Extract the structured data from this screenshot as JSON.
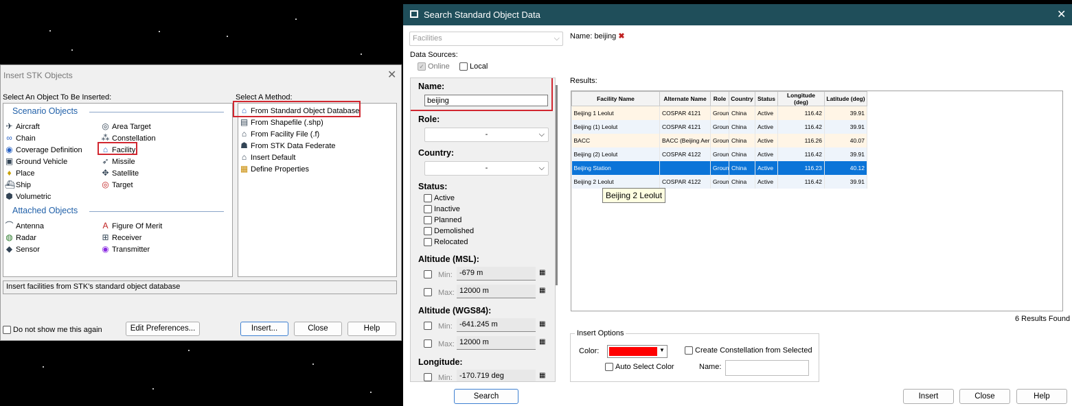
{
  "insert_dialog": {
    "title": "Insert STK Objects",
    "select_object_label": "Select An Object To Be Inserted:",
    "select_method_label": "Select A Method:",
    "scenario_group": "Scenario Objects",
    "attached_group": "Attached Objects",
    "scenario_objects": [
      "Aircraft",
      "Area Target",
      "Chain",
      "Constellation",
      "Coverage Definition",
      "Facility",
      "Ground Vehicle",
      "Missile",
      "Place",
      "Satellite",
      "Ship",
      "Target",
      "Volumetric"
    ],
    "attached_objects": [
      "Antenna",
      "Figure Of Merit",
      "Radar",
      "Receiver",
      "Sensor",
      "Transmitter"
    ],
    "methods": [
      "From Standard Object Database",
      "From Shapefile (.shp)",
      "From Facility File (.f)",
      "From STK Data Federate",
      "Insert Default",
      "Define Properties"
    ],
    "status_text": "Insert facilities from STK's standard object database",
    "dont_show_label": "Do not show me this again",
    "edit_prefs": "Edit Preferences...",
    "insert": "Insert...",
    "close": "Close",
    "help": "Help"
  },
  "search_dialog": {
    "title": "Search Standard Object Data",
    "category": "Facilities",
    "data_sources_label": "Data Sources:",
    "online_label": "Online",
    "local_label": "Local",
    "name_label": "Name:",
    "name_value": "beijing",
    "role_label": "Role:",
    "role_value": "-",
    "country_label": "Country:",
    "country_value": "-",
    "status_label": "Status:",
    "statuses": [
      "Active",
      "Inactive",
      "Planned",
      "Demolished",
      "Relocated"
    ],
    "alt_msl_label": "Altitude (MSL):",
    "alt_wgs_label": "Altitude (WGS84):",
    "longitude_label": "Longitude:",
    "min_label": "Min:",
    "max_label": "Max:",
    "alt_msl_min": "-679 m",
    "alt_msl_max": "12000 m",
    "alt_wgs_min": "-641.245 m",
    "alt_wgs_max": "12000 m",
    "lon_min": "-170.719 deg",
    "search_button": "Search",
    "name_filter": "Name: beijing",
    "results_label": "Results:",
    "columns": [
      "Facility Name",
      "Alternate Name",
      "Role",
      "Country",
      "Status",
      "Longitude (deg)",
      "Latitude (deg)"
    ],
    "rows": [
      [
        "Beijing 1 Leolut",
        "COSPAR 4121",
        "Groun",
        "China",
        "Active",
        "116.42",
        "39.91"
      ],
      [
        "Beijing (1) Leolut",
        "COSPAR 4121",
        "Groun",
        "China",
        "Active",
        "116.42",
        "39.91"
      ],
      [
        "BACC",
        "BACC (Beijing Aer",
        "Groun",
        "China",
        "Active",
        "116.26",
        "40.07"
      ],
      [
        "Beijing (2) Leolut",
        "COSPAR 4122",
        "Groun",
        "China",
        "Active",
        "116.42",
        "39.91"
      ],
      [
        "Beijing Station",
        "",
        "Groun",
        "China",
        "Active",
        "116.23",
        "40.12"
      ],
      [
        "Beijing 2 Leolut",
        "COSPAR 4122",
        "Groun",
        "China",
        "Active",
        "116.42",
        "39.91"
      ]
    ],
    "tooltip": "Beijing 2 Leolut",
    "results_count": "6 Results Found",
    "insert_options_label": "Insert Options",
    "color_label": "Color:",
    "color_value": "#ff0000",
    "auto_color_label": "Auto Select Color",
    "constellation_label": "Create Constellation from Selected",
    "constellation_name_label": "Name:",
    "insert": "Insert",
    "close": "Close",
    "help": "Help"
  }
}
